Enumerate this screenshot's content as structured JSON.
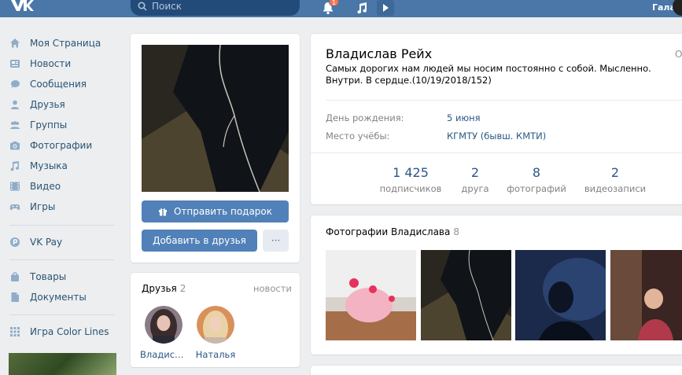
{
  "header": {
    "search_placeholder": "Поиск",
    "notifications_badge": "1",
    "user_name": "Гала"
  },
  "nav": {
    "items": [
      {
        "label": "Моя Страница",
        "icon": "home-icon"
      },
      {
        "label": "Новости",
        "icon": "news-icon"
      },
      {
        "label": "Сообщения",
        "icon": "messages-icon"
      },
      {
        "label": "Друзья",
        "icon": "friends-icon"
      },
      {
        "label": "Группы",
        "icon": "groups-icon"
      },
      {
        "label": "Фотографии",
        "icon": "camera-icon"
      },
      {
        "label": "Музыка",
        "icon": "music-icon"
      },
      {
        "label": "Видео",
        "icon": "video-icon"
      },
      {
        "label": "Игры",
        "icon": "gamepad-icon"
      },
      {
        "label": "VK Pay",
        "icon": "vkpay-icon"
      },
      {
        "label": "Товары",
        "icon": "bag-icon"
      },
      {
        "label": "Документы",
        "icon": "document-icon"
      },
      {
        "label": "Игра Color Lines",
        "icon": "grid-icon"
      }
    ]
  },
  "profile": {
    "gift_button": "Отправить подарок",
    "add_friend_button": "Добавить в друзья",
    "more_button": "···",
    "name": "Владислав Рейх",
    "online": "Он",
    "status": "Самых дорогих нам людей мы носим постоянно с собой. Мысленно. Внутри. В сердце.(10/19/2018/152)",
    "info": [
      {
        "key": "День рождения:",
        "value": "5 июня"
      },
      {
        "key": "Место учёбы:",
        "value": "КГМТУ (бывш. КМТИ)"
      }
    ],
    "counters": [
      {
        "num": "1 425",
        "cap": "подписчиков"
      },
      {
        "num": "2",
        "cap": "друга"
      },
      {
        "num": "8",
        "cap": "фотографий"
      },
      {
        "num": "2",
        "cap": "видеозаписи"
      }
    ]
  },
  "friends": {
    "title": "Друзья",
    "count": "2",
    "news_link": "новости",
    "list": [
      {
        "name": "Владислава"
      },
      {
        "name": "Наталья"
      }
    ]
  },
  "photos": {
    "title": "Фотографии Владислава",
    "count": "8"
  },
  "colors": {
    "header": "#4a76a8",
    "accent": "#5181b8",
    "link": "#2a5885",
    "background": "#edeef0"
  }
}
